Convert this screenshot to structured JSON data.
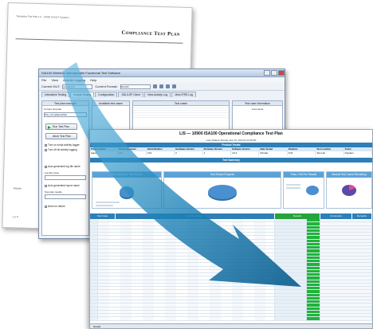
{
  "paper": {
    "header": "Templates Test Plan 1.0 - 10900 ISA/SIT Systems",
    "title": "Compliance Test Plan",
    "side_text_1": "Require",
    "side_text_2": "1.0 Ti"
  },
  "window": {
    "title": "ISA100 Wireless Interoperable Functional Test Software",
    "menu": [
      "File",
      "View",
      "Activity Logging",
      "Help"
    ],
    "toolbar": {
      "current_dut_label": "Current DUT:",
      "current_dut_value": "Device 4.0",
      "current_format_label": "Current Format:",
      "current_format_value": "ISA100"
    },
    "tabs": [
      "Interactive Testing",
      "Scripts Testing",
      "Configuration",
      "SDL/LSP Client",
      "View Activity Log",
      "View IFRS Log"
    ],
    "active_tab_index": 1,
    "panels": {
      "left_title": "Test plan manager",
      "current_plan_label": "Current test plan",
      "current_plan_value": "ISA_CompliancePlan",
      "middle_title": "Available test cases",
      "right_title": "Test cases",
      "far_title": "Test case information",
      "far_sub": "Comments"
    },
    "buttons": {
      "run": "Run Test Plan",
      "abort": "Abort Test Plan"
    },
    "checks": [
      "Turn on script activity logger",
      "Turn off all activity logging",
      "Auto generated log file name",
      "Auto generated report name"
    ],
    "log_file_label": "Log file name",
    "report_label": "Test plan results",
    "abort_label": "Abort on failure"
  },
  "sheet": {
    "title": "LIS — 10900 ISA100 Operational Compliance Test Plan",
    "subtitle": "Last Updated: Monday, Dec 15, 2014 01:24:45 PM",
    "product_band": "Product Tested",
    "product_cols": [
      "Product Name",
      "Device Revision",
      "Serial Number",
      "Hardware Version",
      "Firmware Version",
      "Software Version",
      "Date Tested",
      "Duration",
      "Test Location",
      "Tester"
    ],
    "product_vals": [
      "Agent",
      "2.0",
      "0.01",
      "0",
      "1",
      "4.6.2",
      "Monday",
      "6:32",
      "Test Lab",
      "Operator"
    ],
    "summary_band": "Test Summary",
    "summaries": [
      {
        "title": "Test Cases per Test Results"
      },
      {
        "title": "Test Scripts Progress"
      },
      {
        "title": "Pass / Fail Per Results"
      },
      {
        "title": "Manual Test Cases Remaining"
      }
    ],
    "grid_cols": [
      "Test Case",
      "Test Description",
      "Results",
      "Comments",
      "Remarks"
    ],
    "pass_label": "PASS",
    "tab_label": "Results"
  }
}
